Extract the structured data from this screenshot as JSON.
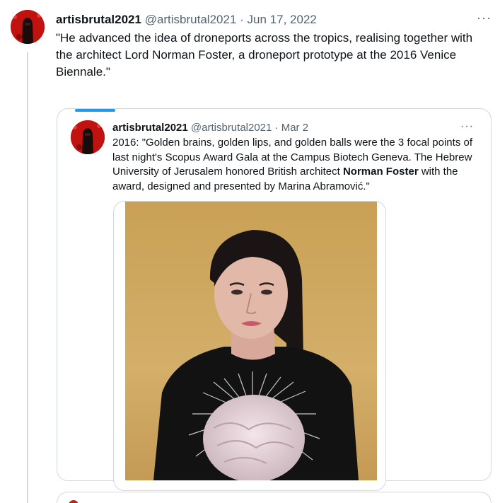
{
  "tweet": {
    "display_name": "artisbrutal2021",
    "handle": "@artisbrutal2021",
    "separator": "·",
    "date": "Jun 17, 2022",
    "more_label": "···",
    "text": "\"He advanced the idea of droneports across the tropics, realising together with the architect Lord Norman Foster, a droneport prototype at the 2016 Venice Biennale.\""
  },
  "quote": {
    "display_name": "artisbrutal2021",
    "handle": "@artisbrutal2021",
    "separator": "·",
    "date": "Mar 2",
    "more_label": "···",
    "text_before": "2016: \"Golden brains, golden lips, and golden balls were the 3 focal points of last night's Scopus Award Gala at the Campus Biotech Geneva. The Hebrew University of Jerusalem honored British architect ",
    "text_bold": "Norman Foster",
    "text_after": " with the award,  designed and presented by Marina Abramović.\""
  },
  "icons": {
    "avatar": "red-avatar-icon",
    "more": "more-options-icon"
  },
  "colors": {
    "accent": "#1d9bf0",
    "secondary_text": "#536471",
    "border": "#cfd9de",
    "avatar_red": "#c0120e"
  }
}
